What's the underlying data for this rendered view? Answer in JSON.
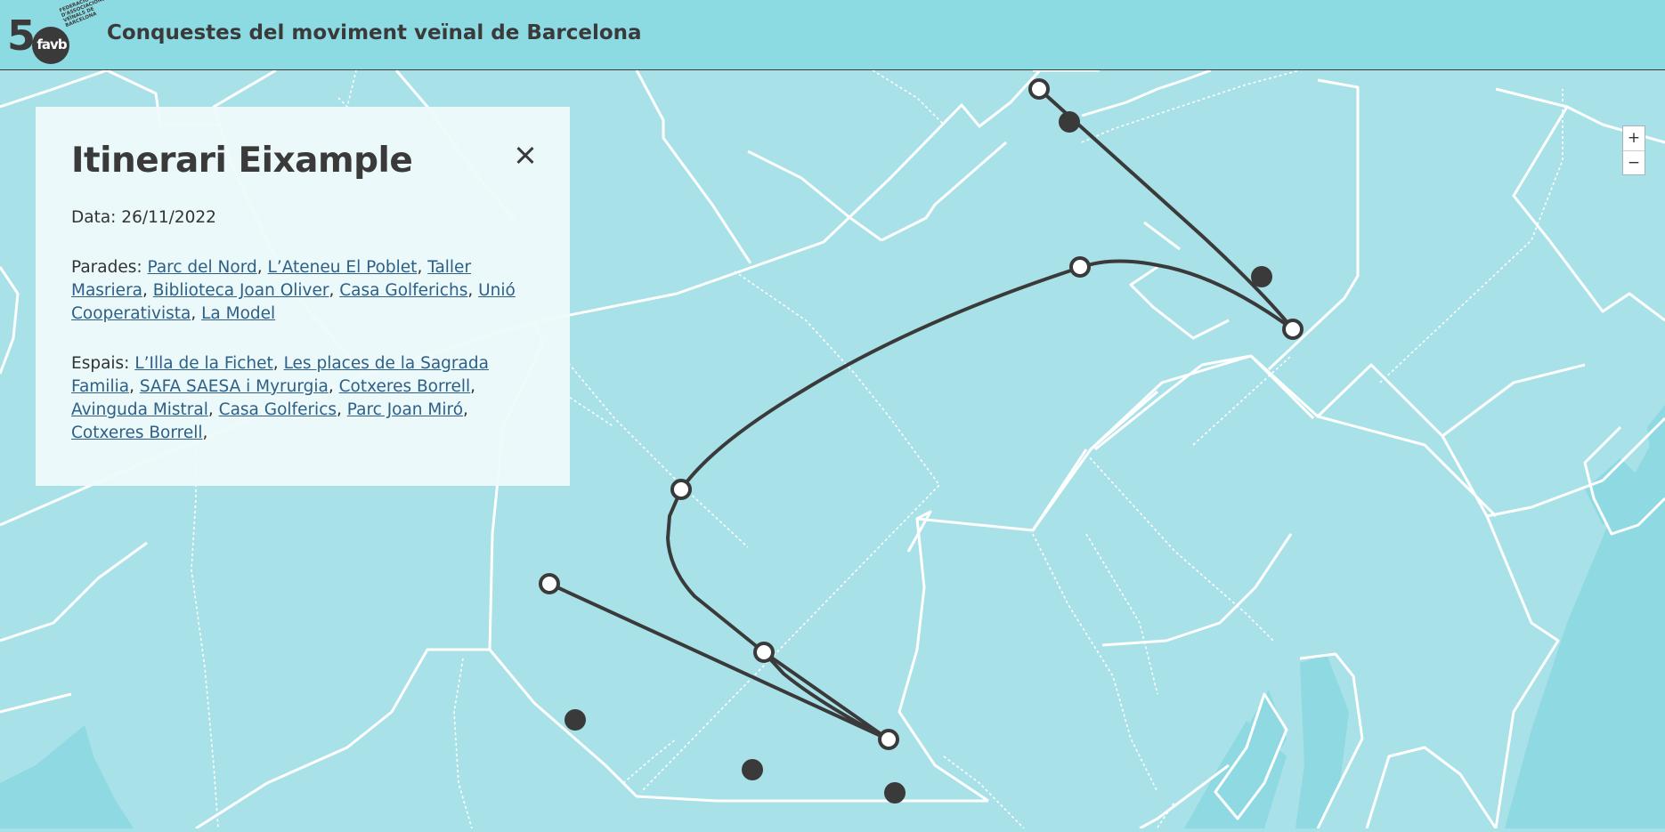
{
  "header": {
    "logo": {
      "number": "5",
      "brand": "favb",
      "small_text": "FEDERACIÓ D'ASSOCIACIONS VEÏNALS DE BARCELONA"
    },
    "title": "Conquestes del moviment veïnal de Barcelona"
  },
  "map": {
    "zoom_in": "+",
    "zoom_out": "−"
  },
  "panel": {
    "title": "Itinerari Eixample",
    "close_icon": "close-icon",
    "date_label": "Data:",
    "date_value": "26/11/2022",
    "stops_label": "Parades:",
    "stops": [
      "Parc del Nord",
      "L’Ateneu El Poblet",
      "Taller Masriera",
      "Biblioteca Joan Oliver",
      "Casa Golferichs",
      "Unió Cooperativista",
      "La Model"
    ],
    "spaces_label": "Espais:",
    "spaces": [
      "L’Illa de la Fichet",
      "Les places de la Sagrada Familia",
      "SAFA SAESA i Myrurgia",
      "Cotxeres Borrell",
      "Avinguda Mistral",
      "Casa Golferics",
      "Parc Joan Miró",
      "Cotxeres Borrell"
    ]
  },
  "colors": {
    "header_bg": "#8cdbe3",
    "map_bg": "#a8e1e7",
    "water": "#8fd9e2",
    "route": "#3a3a3a",
    "link": "#2e5f86"
  }
}
